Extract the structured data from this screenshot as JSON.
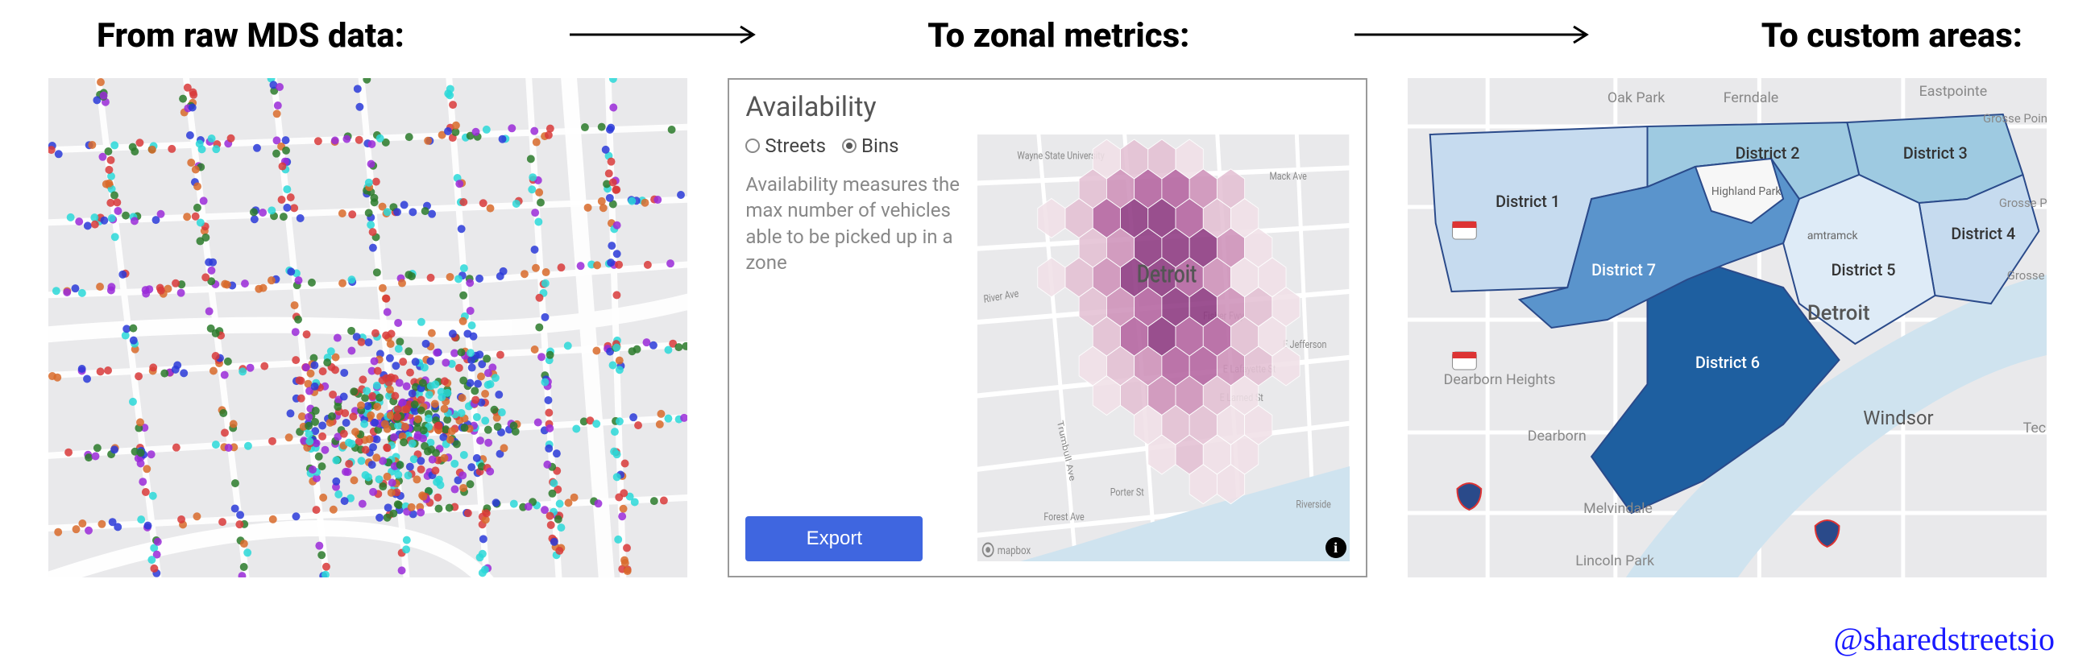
{
  "headers": {
    "h1": "From raw MDS data:",
    "h2": "To zonal metrics:",
    "h3": "To custom areas:"
  },
  "panel2": {
    "title": "Availability",
    "radio_streets": "Streets",
    "radio_bins": "Bins",
    "desc": "Availability measures the max number of vehicles able to be picked up in a zone",
    "export": "Export",
    "city": "Detroit",
    "mapbox": "mapbox",
    "info": "i",
    "streets": {
      "wayne": "Wayne State University",
      "mack": "Mack Ave",
      "river": "River Ave",
      "fisher": "Fisher Fwy",
      "lafayette": "E Lafayette St",
      "larned": "E Larned St",
      "jefferson": "E Jefferson",
      "forest": "Forest Ave",
      "trumbull": "Trumbull Ave",
      "porter": "Porter St",
      "riverside": "Riverside"
    }
  },
  "panel3": {
    "city": "Detroit",
    "windsor": "Windsor",
    "districts": {
      "d1": "District 1",
      "d2": "District 2",
      "d3": "District 3",
      "d4": "District 4",
      "d5": "District 5",
      "d6": "District 6",
      "d7": "District 7"
    },
    "places": {
      "oakpark": "Oak Park",
      "ferndale": "Ferndale",
      "eastpointe": "Eastpointe",
      "grossewoods": "Grosse Pointe Woods",
      "grossefarm": "Grosse Pointe Farm",
      "grosse": "Grosse",
      "highland": "Highland Park",
      "hamtramck": "amtramck",
      "dearbornheights": "Dearborn Heights",
      "dearborn": "Dearborn",
      "melvindale": "Melvindale",
      "lincolnpark": "Lincoln Park",
      "tecumseh": "Tecu"
    }
  },
  "attribution": "@sharedstreetsio"
}
